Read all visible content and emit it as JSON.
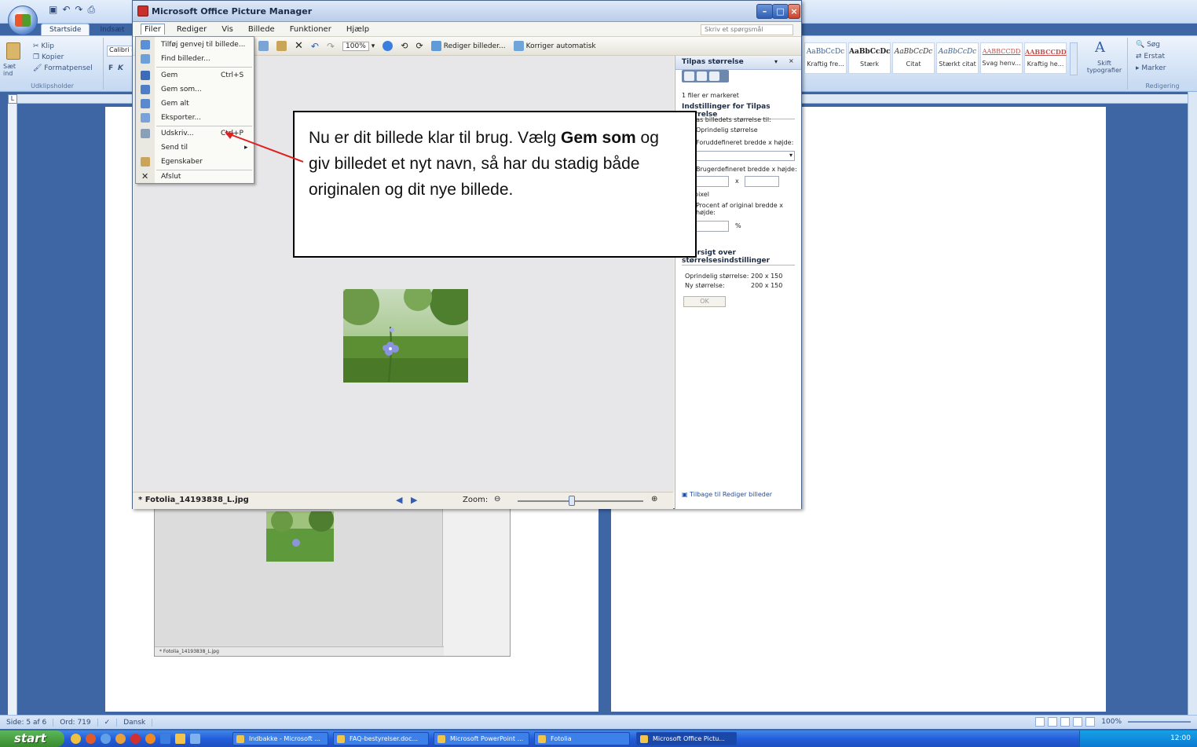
{
  "word": {
    "tabs": [
      "Startside",
      "Indsæt"
    ],
    "clipboard": {
      "paste": "Sæt ind",
      "cut": "Klip",
      "copy": "Kopier",
      "format": "Formatpensel",
      "group": "Udklipsholder"
    },
    "font": {
      "name": "Calibri (t",
      "bold": "F",
      "italic": "K"
    },
    "styles": [
      {
        "preview": "AaBbCcDc",
        "label": "Kraftig fre..."
      },
      {
        "preview": "AaBbCcDc",
        "label": "Stærk"
      },
      {
        "preview": "AaBbCcDc",
        "label": "Citat"
      },
      {
        "preview": "AaBbCcDc",
        "label": "Stærkt citat"
      },
      {
        "preview": "AABBCCDD",
        "label": "Svag henv..."
      },
      {
        "preview": "AABBCCDD",
        "label": "Kraftig he..."
      }
    ],
    "change_styles": "Skift typografier",
    "editing": {
      "find": "Søg",
      "replace": "Erstat",
      "select": "Marker",
      "group": "Redigering"
    },
    "ruler_tab": "L",
    "status": {
      "page": "Side: 5 af 6",
      "words": "Ord: 719",
      "lang": "Dansk",
      "zoom": "100%"
    },
    "embedded_filename": "* Fotolia_14193838_L.jpg"
  },
  "pm": {
    "title": "Microsoft Office Picture Manager",
    "menu": [
      "Filer",
      "Rediger",
      "Vis",
      "Billede",
      "Funktioner",
      "Hjælp"
    ],
    "ask_placeholder": "Skriv et spørgsmål",
    "toolbar": {
      "zoom": "100%",
      "edit": "Rediger billeder...",
      "autocorrect": "Korriger automatisk"
    },
    "filename": "* Fotolia_14193838_L.jpg",
    "zoom_label": "Zoom:",
    "zoom_level": 0.43,
    "file_menu": [
      {
        "label": "Tilføj genvej til billede...",
        "shortcut": "",
        "icon": "add-shortcut-icon"
      },
      {
        "label": "Find billeder...",
        "shortcut": "",
        "icon": "find-icon"
      },
      {
        "label": "Gem",
        "shortcut": "Ctrl+S",
        "icon": "save-icon"
      },
      {
        "label": "Gem som...",
        "shortcut": "",
        "icon": "save-as-icon"
      },
      {
        "label": "Gem alt",
        "shortcut": "",
        "icon": "save-all-icon"
      },
      {
        "label": "Eksporter...",
        "shortcut": "",
        "icon": "export-icon"
      },
      {
        "label": "Udskriv...",
        "shortcut": "Ctrl+P",
        "icon": "print-icon"
      },
      {
        "label": "Send til",
        "shortcut": "",
        "icon": ""
      },
      {
        "label": "Egenskaber",
        "shortcut": "",
        "icon": "properties-icon"
      },
      {
        "label": "Afslut",
        "shortcut": "",
        "icon": "close-icon"
      }
    ],
    "pane": {
      "title": "Tilpas størrelse",
      "selected": "1 filer er markeret",
      "settings_heading": "Indstillinger for Tilpas størrelse",
      "resize_to": "Tilpas billedets størrelse til:",
      "opt_original": "Oprindelig størrelse",
      "opt_predefined": "Foruddefineret bredde x højde:",
      "opt_custom": "Brugerdefineret bredde x højde:",
      "times": "x",
      "pixel": "pixel",
      "opt_percent": "Procent af original bredde x højde:",
      "percent_sign": "%",
      "overview_heading": "Oversigt over størrelsesindstillinger",
      "orig_label": "Oprindelig størrelse:",
      "orig_value": "200 x 150",
      "new_label": "Ny størrelse:",
      "new_value": "200 x 150",
      "ok": "OK",
      "back_link": "Tilbage til Rediger billeder"
    }
  },
  "callout": {
    "before": "Nu er dit billede klar til brug. Vælg ",
    "bold1": "Gem",
    "space": " ",
    "bold2": "som",
    "after": " og giv billedet et nyt navn, så har du stadig både originalen og dit nye billede."
  },
  "taskbar": {
    "start": "start",
    "items": [
      "Indbakke - Microsoft ...",
      "FAQ-bestyrelser.doc...",
      "Microsoft PowerPoint ...",
      "Fotolia",
      "Microsoft Office Pictu..."
    ],
    "clock": "12:00"
  },
  "colors": {
    "annotation_arrow": "#e02020",
    "word_background": "#3e66a4"
  }
}
